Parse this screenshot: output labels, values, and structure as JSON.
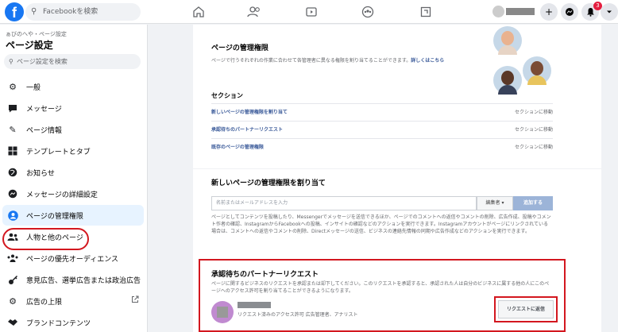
{
  "topbar": {
    "logo": "f",
    "search_placeholder": "Facebookを検索",
    "notification_count": "3",
    "nav_icons": [
      "home-icon",
      "friends-icon",
      "watch-icon",
      "groups-icon",
      "pages-icon"
    ]
  },
  "sidebar": {
    "breadcrumb": "ぁびのへや・ページ設定",
    "title": "ページ設定",
    "search_placeholder": "ページ設定を検索",
    "items": [
      {
        "label": "一般",
        "icon": "gear-icon"
      },
      {
        "label": "メッセージ",
        "icon": "message-icon"
      },
      {
        "label": "ページ情報",
        "icon": "pencil-icon"
      },
      {
        "label": "テンプレートとタブ",
        "icon": "grid-icon"
      },
      {
        "label": "お知らせ",
        "icon": "globe-icon"
      },
      {
        "label": "メッセージの詳細設定",
        "icon": "messenger-icon"
      },
      {
        "label": "ページの管理権限",
        "icon": "person-icon"
      },
      {
        "label": "人物と他のページ",
        "icon": "people-icon"
      },
      {
        "label": "ページの優先オーディエンス",
        "icon": "audience-icon"
      },
      {
        "label": "意見広告、選挙広告または政治広告",
        "icon": "key-icon"
      },
      {
        "label": "広告の上限",
        "icon": "settings-icon"
      },
      {
        "label": "ブランドコンテンツ",
        "icon": "handshake-icon"
      }
    ]
  },
  "roles": {
    "title": "ページの管理権限",
    "description": "ページで行うそれぞれの作業に合わせて各管理者に異なる権限を割り当てることができます。",
    "learn_more": "詳しくはこちら",
    "sections_label": "セクション",
    "sections": [
      {
        "label": "新しいページの管理権限を割り当て",
        "action": "セクションに移動"
      },
      {
        "label": "承認待ちのパートナーリクエスト",
        "action": "セクションに移動"
      },
      {
        "label": "既存のページの管理権限",
        "action": "セクションに移動"
      }
    ]
  },
  "assign": {
    "title": "新しいページの管理権限を割り当て",
    "input_placeholder": "名前またはメールアドレスを入力",
    "role": "編集者 ▾",
    "add_button": "追加する",
    "description": "ページとしてコンテンツを投稿したり、Messengerでメッセージを送信できるほか、ページでのコメントへの返信やコメントの削除、広告作成、投稿やコメント作者の確認、InstagramからFacebookへの投稿、インサイトの確認などのアクションを実行できます。Instagramアカウントがページにリンクされている場合は、コメントへの返信やコメントの削除、Directメッセージの送信、ビジネスの連絡先情報の同期や広告作成などのアクションを実行できます。"
  },
  "partner": {
    "title": "承認待ちのパートナーリクエスト",
    "description": "ページに関するビジネスのリクエストを承認または却下してください。このリクエストを承認すると、承認された人は自分のビジネスに属する他の人にこのページへのアクセス許可を割り当てることができるようになります。",
    "sub": "リクエスト済みのアクセス許可  広告管理者、アナリスト",
    "resend_button": "リクエストに返信"
  }
}
